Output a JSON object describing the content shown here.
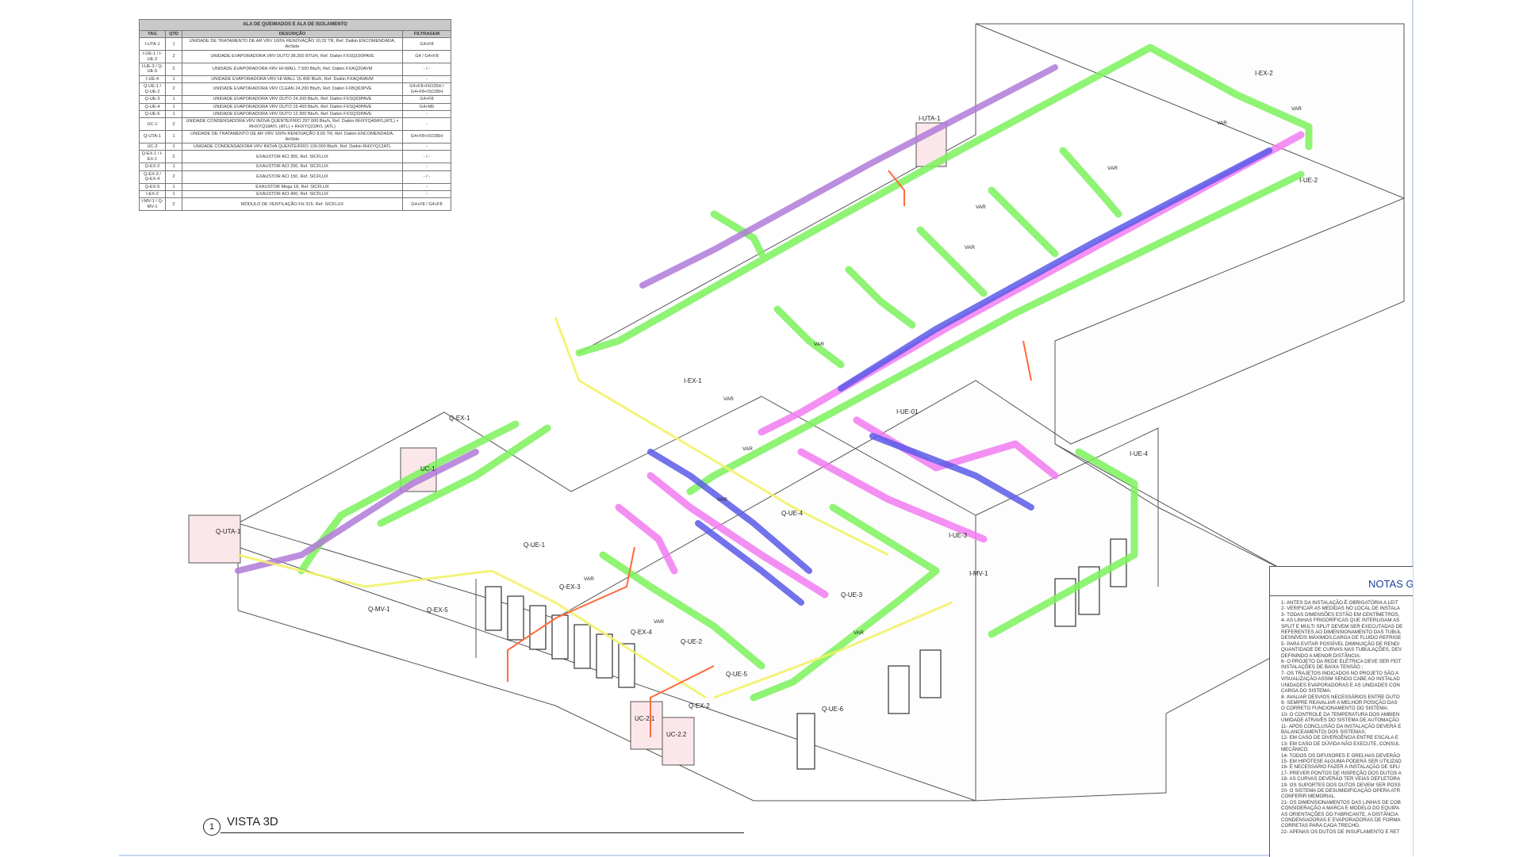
{
  "colors": {
    "supply_duct": "#7cf25c",
    "return_duct": "#f27cf2",
    "exhaust_duct": "#b07ad8",
    "evaporator_duct": "#5a5ae8",
    "refrigerant_line": "#ff6a3d",
    "drain_line": "#f2f26a",
    "building_outline": "#444444",
    "notes_title": "#1d3fa0"
  },
  "table": {
    "title": "ALA DE QUEIMADOS E ALA DE ISOLAMENTO",
    "headers": {
      "tag": "TAG",
      "qty": "QTD",
      "desc": "DESCRIÇÃO",
      "filter": "FILTRAGEM"
    },
    "rows": [
      {
        "tag": "I-UTA-1",
        "qty": "1",
        "desc": "UNIDADE DE TRATAMENTO DE AR VRV 100% RENOVAÇÃO 10,32 TR, Ref. Daikin ENCOMENDADA, AirSide",
        "filter": "G4+F8"
      },
      {
        "tag": "I-UE-1 / I-UE-2",
        "qty": "2",
        "desc": "UNIDADE EVAPORADORA VRV DUTO 38.200 BTU/h, Ref. Daikin FXSQ100PAVE",
        "filter": "G4 / G4+F8"
      },
      {
        "tag": "I-UE-3 / Q-UE-5",
        "qty": "2",
        "desc": "UNIDADE EVAPORADORA VRV HI-WALL 7.500 Btu/h, Ref. Daikin FXAQ20AVM",
        "filter": "- / -"
      },
      {
        "tag": "I-UE-4",
        "qty": "1",
        "desc": "UNIDADE EVAPORADORA VRV HI-WALL 15.400 Btu/h, Ref. Daikin FXAQ40AVM",
        "filter": "-"
      },
      {
        "tag": "Q-UE-1 / Q-UE-2",
        "qty": "2",
        "desc": "UNIDADE EVAPORADORA VRV CLEAN 24.200 Btu/h, Ref. Daikin FXBQ63PVE",
        "filter": "G4+F8+ISO35H / G4+F8+ISO35H"
      },
      {
        "tag": "Q-UE-3",
        "qty": "1",
        "desc": "UNIDADE EVAPORADORA VRV DUTO 24.200 Btu/h, Ref. Daikin FXSQ63PAVE",
        "filter": "G4+F8"
      },
      {
        "tag": "Q-UE-4",
        "qty": "1",
        "desc": "UNIDADE EVAPORADORA VRV DUTO 15.400 Btu/h, Ref. Daikin FXSQ40PAVE",
        "filter": "G4+M5"
      },
      {
        "tag": "Q-UE-6",
        "qty": "1",
        "desc": "UNIDADE EVAPORADORA VRV DUTO 12.300 Btu/h, Ref. Daikin FXSQ32PAVE",
        "filter": "-"
      },
      {
        "tag": "UC-1",
        "qty": "2",
        "desc": "UNIDADE CONDENSADORA VRV INOVA QUENTE/FRIO 297.000 Btu/h, Ref. Daikin RHXYQ40AYL(ATL) + RHXYQ18AYL (ATL) + RHXYQ22AYL (ATL)",
        "filter": "-"
      },
      {
        "tag": "Q-UTA-1",
        "qty": "1",
        "desc": "UNIDADE DE TRATAMENTO DE AR VRV 100% RENOVAÇÃO 8,65 TR, Ref. Daikin ENCOMENDADA, AirSide",
        "filter": "G4+F8+ISO35H"
      },
      {
        "tag": "UC-2",
        "qty": "1",
        "desc": "UNIDADE CONDENSADORA VRV INOVA QUENTE/FRIO 100.000 Btu/h, Ref. Daikin RHXYQ12ATL",
        "filter": "-"
      },
      {
        "tag": "Q-EX-1 / I-EX-1",
        "qty": "2",
        "desc": "EXAUSTOR ACI 355, Ref. SICFLUX",
        "filter": "- / -"
      },
      {
        "tag": "Q-EX-2",
        "qty": "1",
        "desc": "EXAUSTOR ACI 200, Ref. SICFLUX",
        "filter": "-"
      },
      {
        "tag": "Q-EX-3 / Q-EX-4",
        "qty": "2",
        "desc": "EXAUSTOR ACI 150, Ref. SICFLUX",
        "filter": "- / -"
      },
      {
        "tag": "Q-EX-5",
        "qty": "1",
        "desc": "EXAUSTOR Mega 18, Ref. SICFLUX",
        "filter": "-"
      },
      {
        "tag": "I-EX-2",
        "qty": "1",
        "desc": "EXAUSTOR ACI 400, Ref. SICFLUX",
        "filter": "-"
      },
      {
        "tag": "I-MV-1 / Q-MV-1",
        "qty": "2",
        "desc": "MÓDULO DE VENTILAÇÃO FH 315, Ref. SICFLUX",
        "filter": "G4+F8 / G4+F8"
      }
    ]
  },
  "view": {
    "number": "1",
    "title": "VISTA 3D",
    "equipment_labels": [
      {
        "id": "i-uta-1",
        "text": "I-UTA-1"
      },
      {
        "id": "i-ex-2",
        "text": "I-EX-2"
      },
      {
        "id": "i-ue-2",
        "text": "I-UE-2"
      },
      {
        "id": "i-ex-1",
        "text": "I-EX-1"
      },
      {
        "id": "i-ue-01",
        "text": "I-UE-01"
      },
      {
        "id": "i-ue-4",
        "text": "I-UE-4"
      },
      {
        "id": "i-ue-3",
        "text": "I-UE-3"
      },
      {
        "id": "i-mv-1",
        "text": "I-MV-1"
      },
      {
        "id": "q-ex-1",
        "text": "Q-EX-1"
      },
      {
        "id": "uc-1",
        "text": "UC-1"
      },
      {
        "id": "q-uta-1",
        "text": "Q-UTA-1"
      },
      {
        "id": "q-ue-1",
        "text": "Q-UE-1"
      },
      {
        "id": "q-ue-4",
        "text": "Q-UE-4"
      },
      {
        "id": "q-ex-3",
        "text": "Q-EX-3"
      },
      {
        "id": "q-ue-3",
        "text": "Q-UE-3"
      },
      {
        "id": "q-ex-4",
        "text": "Q-EX-4"
      },
      {
        "id": "q-ue-2",
        "text": "Q-UE-2"
      },
      {
        "id": "q-mv-1",
        "text": "Q-MV-1"
      },
      {
        "id": "q-ex-5",
        "text": "Q-EX-5"
      },
      {
        "id": "q-ue-5",
        "text": "Q-UE-5"
      },
      {
        "id": "q-ex-2",
        "text": "Q-EX-2"
      },
      {
        "id": "q-ue-6",
        "text": "Q-UE-6"
      },
      {
        "id": "uc-2-1",
        "text": "UC-2.1"
      },
      {
        "id": "uc-2-2",
        "text": "UC-2.2"
      }
    ],
    "var_label": "VAR"
  },
  "notes": {
    "title": "NOTAS G",
    "items": [
      "1- ANTES DA INSTALAÇÃO É OBRIGATÓRIA A LEIT",
      "2- VERIFICAR AS MEDIDAS NO LOCAL DE INSTALA",
      "3- TODAS DIMENSÕES ESTÃO EM CENTÍMETROS,",
      "4- AS LINHAS FRIGORÍFICAS QUE INTERLIGAM AS",
      "SPLIT E MULTI SPLIT DEVEM SER EXECUTADAS DE",
      "REFERENTES AO DIMENSIONAMENTO DAS TUBUL",
      "DESNÍVEIS MÁXIMOS,CARGA DE FLUIDO REFRIGE",
      "5- PARA EVITAR POSSÍVEL DIMINUIÇÃO DE RENDI",
      "QUANTIDADE DE CURVAS NAS TUBULAÇÕES, DEV",
      "DEFININDO A MENOR DISTÂNCIA;",
      "6- O PROJETO DA REDE ELÉTRICA DEVE SER FEIT",
      "INSTALAÇÕES DE BAIXA TENSÃO ;",
      "7- OS TRAJETOS INDICADOS NO PROJETO SÃO A",
      "VISUALIZAÇÃO ASSIM SENDO CABE AO INSTALAD",
      "UNIDADES EVAPORADORAS E AS UNIDADES CON",
      "CARGA DO SISTEMA;",
      "8- AVALIAR DESVIOS NECESSÁRIOS ENTRE DUTO",
      "9- SEMPRE REAVALIAR A MELHOR POSIÇÃO DAS",
      "O CORRETO FUNCIONAMENTO DO SISTEMA;",
      "10- O CONTROLE DA TEMPERATURA DOS AMBIEN",
      "UMIDADE ATRAVÉS DO SISTEMA DE AUTOMAÇÃO",
      "11- APÓS CONCLUSÃO DA INSTALAÇÃO DEVERÁ E",
      "BALANCEAMENTO) DOS SISTEMAS;",
      "12- EM CASO DE DIVERGÊNCIA ENTRE ESCALA E",
      "13- EM CASO DE DÚVIDA NÃO EXECUTE, CONSUL",
      "MECÂNICO.",
      "14- TODOS OS DIFUSORES E GRELHAS DEVERÃO",
      "15- EM HIPÓTESE ALGUMA PODERÁ SER UTILIZAD",
      "16- É NECESSÁRIO FAZER A INSTALAÇÃO DE SPLI",
      "17- PREVER PONTOS DE INSPEÇÃO DOS DUTOS A",
      "18- AS CURVAS DEVERÃO TER VEIAS DEFLETORA",
      "19- OS SUPORTES DOS DUTOS DEVEM SER POSS",
      "20- O SISTEMA DE DESUMIDIFICAÇÃO OPERA ATR",
      "CONFERIR MEMORIAL.",
      "21- OS DIMENSIONAMENTOS DAS LINHAS DE COB",
      "CONSIDERAÇÃO A MARCA E MODELO DO EQUIPA",
      "AS ORIENTAÇÕES DO FABRICANTE, A DISTÂNCIA",
      "CONDENSADORAS E EVAPORADORAS DE FORMA",
      "CORRETAS PARA CADA TRECHO.",
      "22- APENAS OS DUTOS DE INSUFLAMENTO E RET"
    ]
  }
}
